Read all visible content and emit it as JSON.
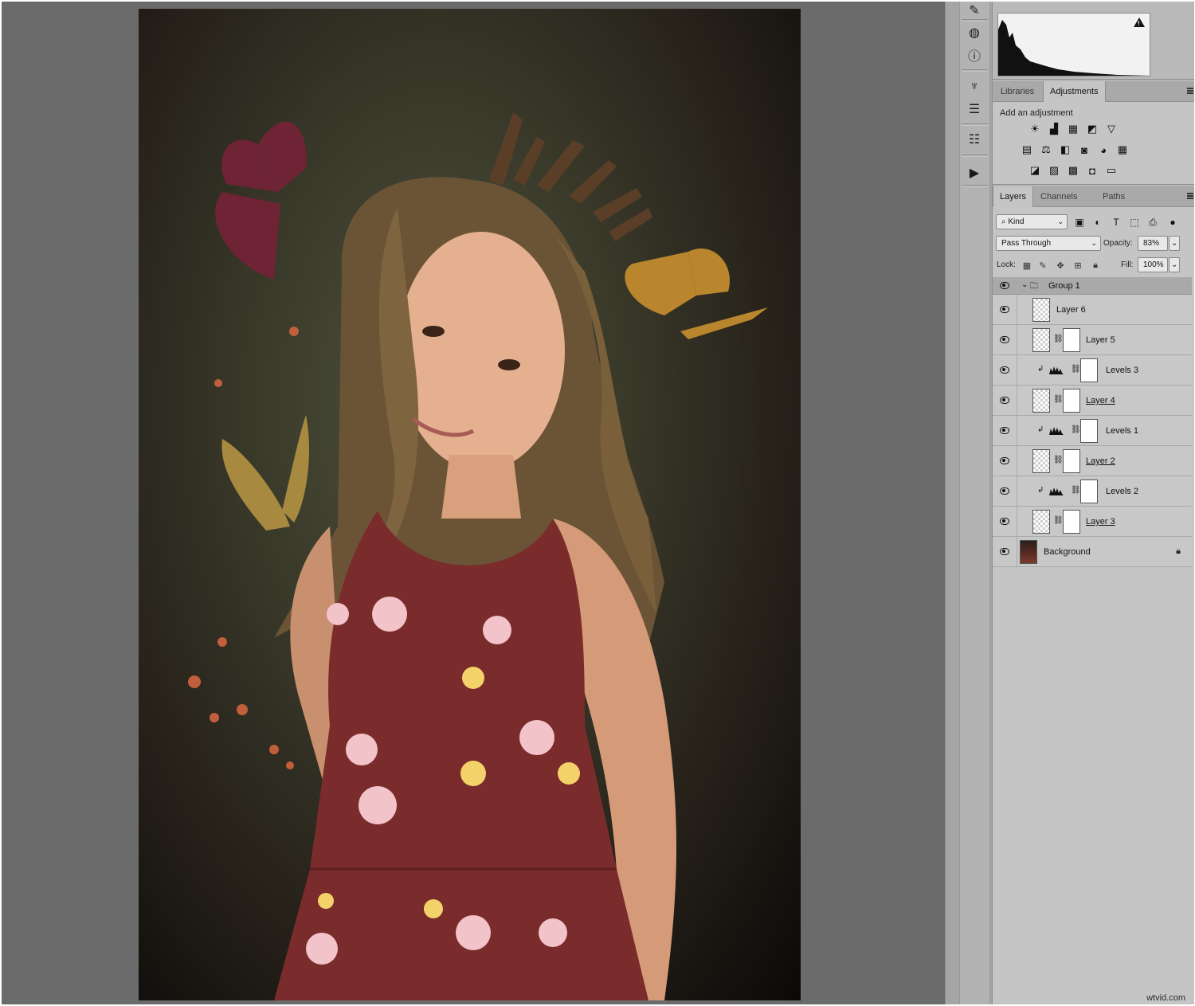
{
  "panels": {
    "adjustments_tabs": [
      "Libraries",
      "Adjustments"
    ],
    "add_adjustment_label": "Add an adjustment",
    "adjustment_icons": [
      [
        "brightness-contrast-icon",
        "levels-icon",
        "curves-icon",
        "exposure-icon",
        "vibrance-icon"
      ],
      [
        "hue-saturation-icon",
        "color-balance-icon",
        "black-white-icon",
        "photo-filter-icon",
        "channel-mixer-icon",
        "color-lookup-icon"
      ],
      [
        "invert-icon",
        "posterize-icon",
        "threshold-icon",
        "selective-color-icon",
        "gradient-map-icon"
      ]
    ],
    "layers_tabs": [
      "Layers",
      "Channels",
      "Paths"
    ]
  },
  "layers": {
    "filter_kind": "Kind",
    "blend_mode": "Pass Through",
    "opacity_label": "Opacity:",
    "opacity_value": "83%",
    "lock_label": "Lock:",
    "fill_label": "Fill:",
    "fill_value": "100%",
    "group_name": "Group 1",
    "items": [
      {
        "name": "Layer 6"
      },
      {
        "name": "Layer 5"
      },
      {
        "name": "Levels 3"
      },
      {
        "name": "Layer 4"
      },
      {
        "name": "Levels 1"
      },
      {
        "name": "Layer 2"
      },
      {
        "name": "Levels 2"
      },
      {
        "name": "Layer 3"
      },
      {
        "name": "Background"
      }
    ]
  },
  "colors": {
    "panel_bg": "#c5c5c5",
    "canvas_bg": "#6b6b6b",
    "dress": "#7a2b2b"
  },
  "watermark": "wtvid.com"
}
